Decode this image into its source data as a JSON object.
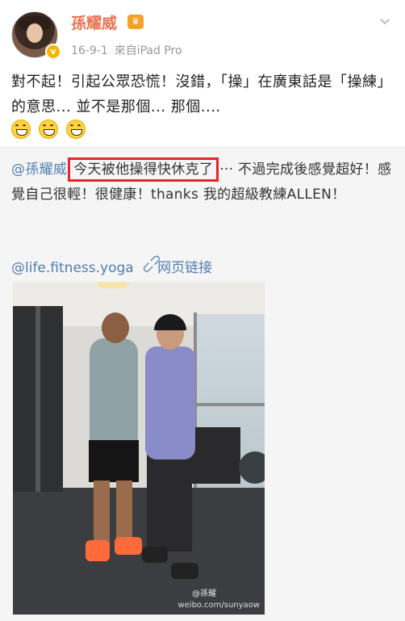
{
  "post": {
    "username": "孫耀威",
    "date": "16-9-1",
    "source": "來自iPad Pro",
    "text": "對不起！引起公眾恐慌！沒錯，「操」在廣東話是「操練」的意思... 並不是那個... 那個....",
    "emoji_count": 3
  },
  "repost": {
    "mention": "@孫耀威",
    "highlighted": "今天被他操得快休克了",
    "text_after_highlight": "··· 不過完成後感覺超好！感覺自己很輕！很健康！thanks 我的超級教練ALLEN！",
    "link_account": "@life.fitness.yoga",
    "link_label": "网页链接"
  },
  "photo": {
    "watermark": "weibo.com/sunyaow",
    "watermark_logo": "@孫耀"
  },
  "colors": {
    "username": "#eb7350",
    "mention": "#507daf",
    "highlight_border": "#e4262b",
    "repost_bg": "#f5f5f5"
  }
}
